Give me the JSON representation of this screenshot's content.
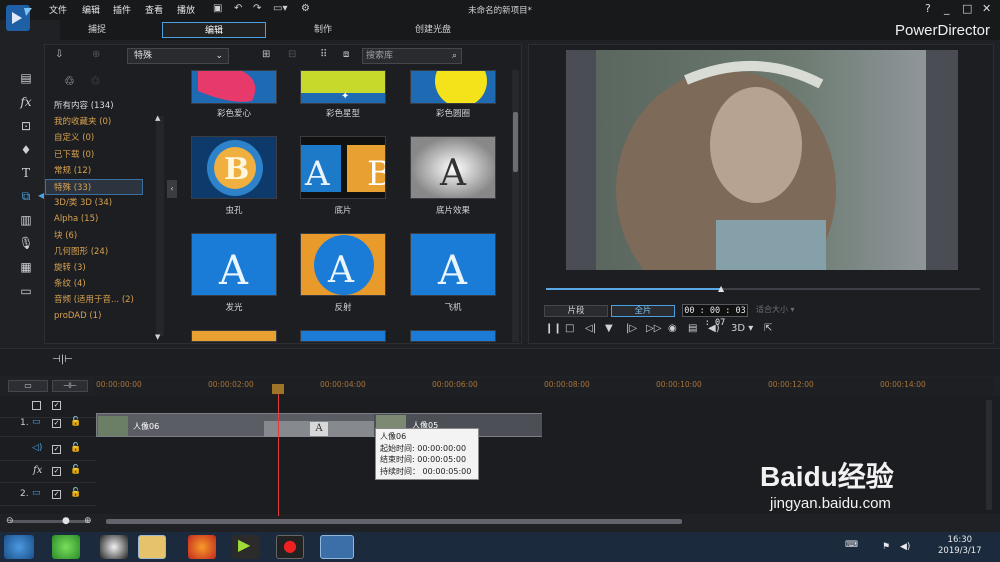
{
  "titlebar": {
    "menu": [
      "文件",
      "编辑",
      "插件",
      "查看",
      "播放"
    ],
    "title": "未命名的新项目*",
    "window_controls": [
      "?",
      "_",
      "□",
      "✕"
    ]
  },
  "modes": {
    "tabs": [
      "捕捉",
      "编辑",
      "制作",
      "创建光盘"
    ],
    "active": "编辑",
    "brand": "PowerDirector"
  },
  "library": {
    "category_select": "特殊",
    "search_placeholder": "搜索库",
    "categories": [
      "所有内容 (134)",
      "我的收藏夹 (0)",
      "自定义 (0)",
      "已下载 (0)",
      "常规 (12)",
      "特殊 (33)",
      "3D/类 3D (34)",
      "Alpha (15)",
      "块 (6)",
      "几何图形 (24)",
      "旋转 (3)",
      "条纹 (4)",
      "音频 (适用于音... (2)",
      "proDAD (1)"
    ],
    "selected_category": "特殊",
    "items": [
      {
        "label": "彩色爱心"
      },
      {
        "label": "彩色星型"
      },
      {
        "label": "彩色圆圈"
      },
      {
        "label": "虫孔"
      },
      {
        "label": "底片"
      },
      {
        "label": "底片效果"
      },
      {
        "label": "发光"
      },
      {
        "label": "反射"
      },
      {
        "label": "飞机"
      }
    ]
  },
  "preview": {
    "clip_tab": "片段",
    "movie_tab": "全片",
    "timecode": "00 : 00 : 03 : 07",
    "fit_size": "适合大小",
    "mode_3d": "3D",
    "seek_progress": 0.41
  },
  "timeline": {
    "ticks": [
      "00:00:00:00",
      "00:00:02:00",
      "00:00:04:00",
      "00:00:06:00",
      "00:00:08:00",
      "00:00:10:00",
      "00:00:12:00",
      "00:00:14:00"
    ],
    "tracks": [
      {
        "num": "1."
      },
      {
        "num": ""
      },
      {
        "num": ""
      },
      {
        "num": "2."
      }
    ],
    "clips": [
      {
        "label": "人像06"
      },
      {
        "label": "人像05"
      }
    ],
    "transition_label": "A",
    "tooltip": {
      "title": "人像06",
      "start": "起始时间: 00:00:00:00",
      "end": "结束时间: 00:00:05:00",
      "duration": "持续时间： 00:00:05:00"
    }
  },
  "taskbar": {
    "time": "16:30",
    "date": "2019/3/17"
  },
  "watermark": {
    "brand": "Baidu经验",
    "url": "jingyan.baidu.com"
  }
}
